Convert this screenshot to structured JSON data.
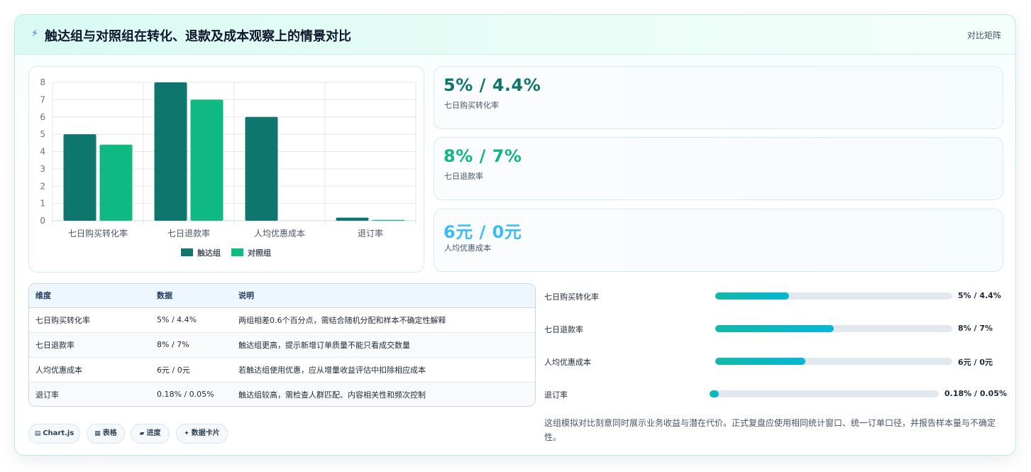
{
  "header": {
    "icon": "lightning-icon",
    "title": "触达组与对照组在转化、退款及成本观察上的情景对比",
    "badge": "对比矩阵"
  },
  "chart_data": {
    "type": "bar",
    "categories": [
      "七日购买转化率",
      "七日退款率",
      "人均优惠成本",
      "退订率"
    ],
    "series": [
      {
        "name": "触达组",
        "values": [
          5,
          8,
          6,
          0.18
        ],
        "color": "#0f766e"
      },
      {
        "name": "对照组",
        "values": [
          4.4,
          7,
          0,
          0.05
        ],
        "color": "#10b981"
      }
    ],
    "ylim": [
      0,
      8
    ],
    "yticks": [
      0,
      1,
      2,
      3,
      4,
      5,
      6,
      7,
      8
    ],
    "grid": true,
    "legend": "bottom"
  },
  "stats": [
    {
      "value": "5% / 4.4%",
      "label": "七日购买转化率",
      "color": "#0f766e"
    },
    {
      "value": "8% / 7%",
      "label": "七日退款率",
      "color": "#10b981"
    },
    {
      "value": "6元 / 0元",
      "label": "人均优惠成本",
      "color": "#38bdf8"
    }
  ],
  "table": {
    "headers": [
      "维度",
      "数据",
      "说明"
    ],
    "rows": [
      [
        "七日购买转化率",
        "5% / 4.4%",
        "两组相差0.6个百分点，需结合随机分配和样本不确定性解释"
      ],
      [
        "七日退款率",
        "8% / 7%",
        "触达组更高，提示新增订单质量不能只看成交数量"
      ],
      [
        "人均优惠成本",
        "6元 / 0元",
        "若触达组使用优惠，应从增量收益评估中扣除相应成本"
      ],
      [
        "退订率",
        "0.18% / 0.05%",
        "触达组较高，需检查人群匹配、内容相关性和频次控制"
      ]
    ]
  },
  "progress": [
    {
      "label": "七日购买转化率",
      "value": "5% / 4.4%",
      "fraction": 0.31
    },
    {
      "label": "七日退款率",
      "value": "8% / 7%",
      "fraction": 0.5
    },
    {
      "label": "人均优惠成本",
      "value": "6元 / 0元",
      "fraction": 0.38
    },
    {
      "label": "退订率",
      "value": "0.18% / 0.05%",
      "fraction": 0.04
    }
  ],
  "note": "这组模拟对比刻意同时展示业务收益与潜在代价。正式复盘应使用相同统计窗口、统一订单口径，并报告样本量与不确定性。",
  "tags": [
    {
      "icon": "chart-icon",
      "glyph": "▤",
      "label": "Chart.js"
    },
    {
      "icon": "table-icon",
      "glyph": "▦",
      "label": "表格"
    },
    {
      "icon": "progress-icon",
      "glyph": "▰",
      "label": "进度"
    },
    {
      "icon": "card-icon",
      "glyph": "✦",
      "label": "数据卡片"
    }
  ]
}
